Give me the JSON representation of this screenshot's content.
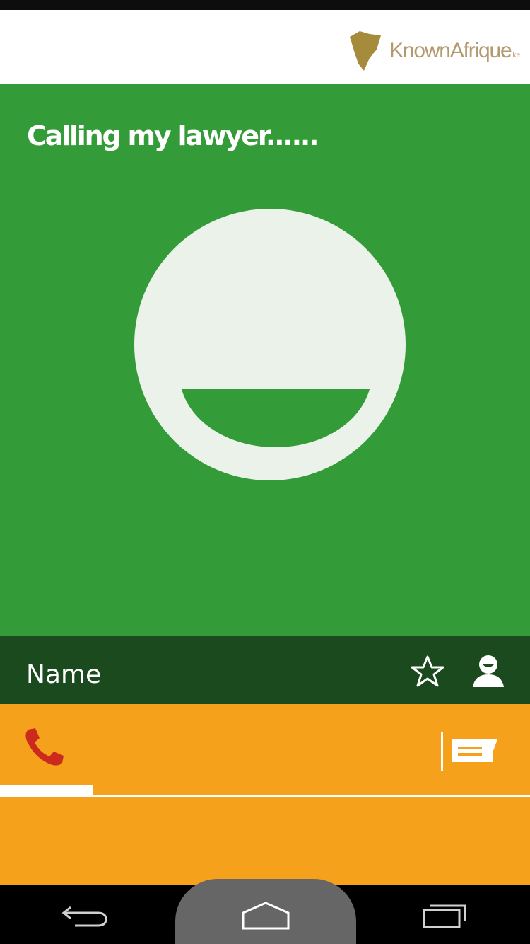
{
  "app": {
    "logo_text": "KnownAfrique",
    "logo_suffix": "ke",
    "brand_color": "#b39a6e"
  },
  "call": {
    "status_text": "Calling my lawyer......",
    "avatar_icon": "smiley-face-icon",
    "background_color": "#339b37"
  },
  "contact": {
    "name": "Name",
    "bar_color": "#1b4a1e",
    "icons": [
      "star-outline-icon",
      "person-icon"
    ]
  },
  "actions": {
    "background_color": "#f5a11c",
    "tabs": [
      {
        "icon": "phone-icon",
        "selected": true,
        "icon_color": "#cc2a1c"
      },
      {
        "icon": "message-icon",
        "selected": false
      }
    ]
  },
  "navigation": {
    "buttons": [
      "back-icon",
      "home-icon",
      "recents-icon"
    ]
  }
}
